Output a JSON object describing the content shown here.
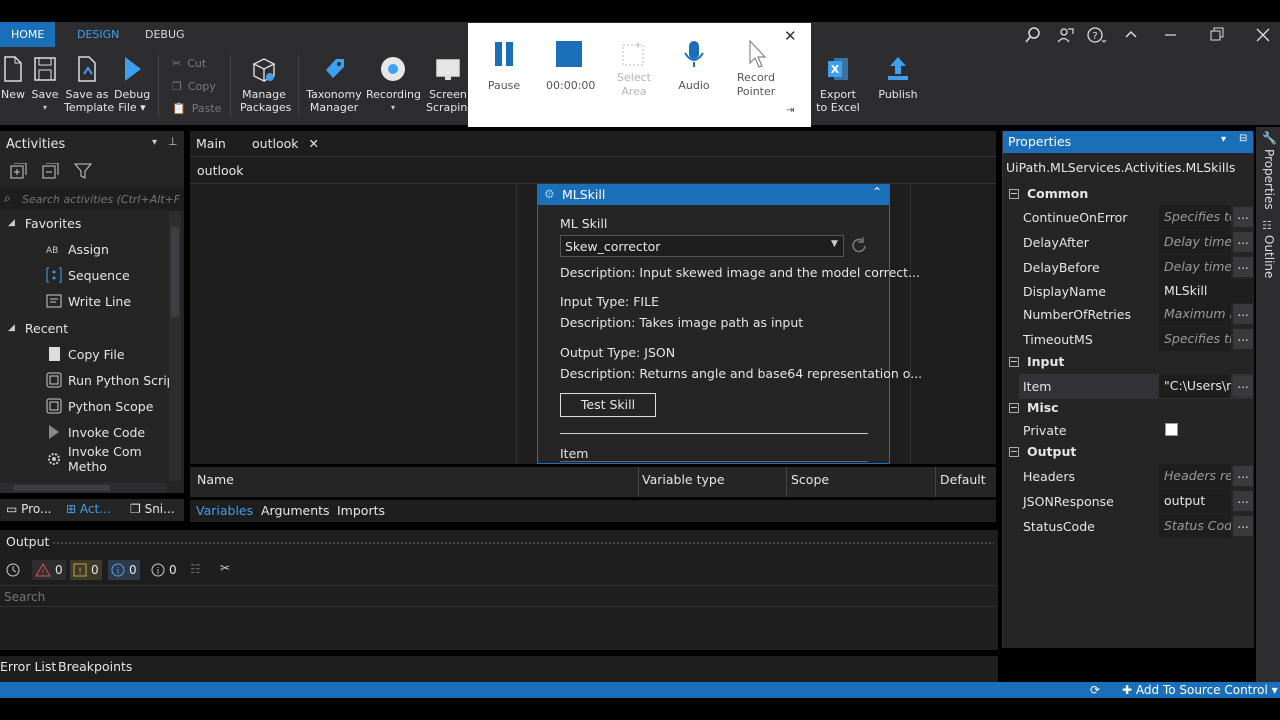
{
  "topbar": {
    "tabs": [
      "HOME",
      "DESIGN",
      "DEBUG"
    ]
  },
  "ribbon": {
    "new": "New",
    "save": "Save",
    "save_as_template": [
      "Save as",
      "Template"
    ],
    "debug_file": [
      "Debug",
      "File"
    ],
    "cut": "Cut",
    "copy": "Copy",
    "paste": "Paste",
    "manage_packages": [
      "Manage",
      "Packages"
    ],
    "taxonomy_manager": [
      "Taxonomy",
      "Manager"
    ],
    "recording": "Recording",
    "screen_scraping": [
      "Screen",
      "Scraping"
    ],
    "export_to_excel": [
      "Export",
      "to Excel"
    ],
    "publish": "Publish"
  },
  "recorder": {
    "pause": "Pause",
    "timer": "00:00:00",
    "select_area": [
      "Select",
      "Area"
    ],
    "audio": "Audio",
    "record_pointer": [
      "Record",
      "Pointer"
    ]
  },
  "activities": {
    "title": "Activities",
    "search_placeholder": "Search activities (Ctrl+Alt+F)",
    "favorites_label": "Favorites",
    "favorites": [
      "Assign",
      "Sequence",
      "Write Line"
    ],
    "recent_label": "Recent",
    "recent": [
      "Copy File",
      "Run Python Script",
      "Python Scope",
      "Invoke Code",
      "Invoke Com Metho"
    ],
    "bottom_tabs": [
      "Pro...",
      "Act...",
      "Sni..."
    ]
  },
  "doc_tabs": [
    "Main",
    "outlook"
  ],
  "breadcrumb": "outlook",
  "mlskill": {
    "title": "MLSkill",
    "ml_skill_label": "ML Skill",
    "selected_skill": "Skew_corrector",
    "description": "Description:  Input skewed image and the model correct...",
    "input_type": "Input Type:  FILE",
    "input_description": "Description:  Takes image path as input",
    "output_type": "Output Type:  JSON",
    "output_description": "Description:  Returns angle and base64 representation o...",
    "test_skill": "Test Skill",
    "item_label": "Item"
  },
  "variables": {
    "columns": [
      "Name",
      "Variable type",
      "Scope",
      "Default"
    ],
    "tabs": [
      "Variables",
      "Arguments",
      "Imports"
    ]
  },
  "output": {
    "title": "Output",
    "counts": [
      "0",
      "0",
      "0",
      "0"
    ],
    "search_placeholder": "Search"
  },
  "bottom_tabs": [
    "Error List",
    "Breakpoints"
  ],
  "statusbar": {
    "source_control": "Add To Source Control"
  },
  "properties": {
    "title": "Properties",
    "type_name": "UiPath.MLServices.Activities.MLSkills",
    "categories": {
      "common": "Common",
      "input": "Input",
      "misc": "Misc",
      "output": "Output"
    },
    "common": [
      {
        "name": "ContinueOnError",
        "value": "Specifies to",
        "italic": true,
        "dots": true
      },
      {
        "name": "DelayAfter",
        "value": "Delay time",
        "italic": true,
        "dots": true
      },
      {
        "name": "DelayBefore",
        "value": "Delay time",
        "italic": true,
        "dots": true
      },
      {
        "name": "DisplayName",
        "value": "MLSkill",
        "italic": false,
        "dots": false
      },
      {
        "name": "NumberOfRetries",
        "value": "Maximum r.",
        "italic": true,
        "dots": true
      },
      {
        "name": "TimeoutMS",
        "value": "Specifies the",
        "italic": true,
        "dots": true
      }
    ],
    "input": [
      {
        "name": "Item",
        "value": "\"C:\\Users\\ra",
        "italic": false,
        "dots": true
      }
    ],
    "misc": [
      {
        "name": "Private",
        "value": "",
        "checkbox": true
      }
    ],
    "output": [
      {
        "name": "Headers",
        "value": "Headers ret",
        "italic": true,
        "dots": true
      },
      {
        "name": "JSONResponse",
        "value": "output",
        "italic": false,
        "dots": true
      },
      {
        "name": "StatusCode",
        "value": "Status Code",
        "italic": true,
        "dots": true
      }
    ]
  },
  "side_tabs": [
    "Properties",
    "Outline"
  ],
  "colors": {
    "accent": "#1a6fb8",
    "panel": "#252526",
    "editor": "#1e1e1e",
    "chrome": "#2d2d30"
  }
}
